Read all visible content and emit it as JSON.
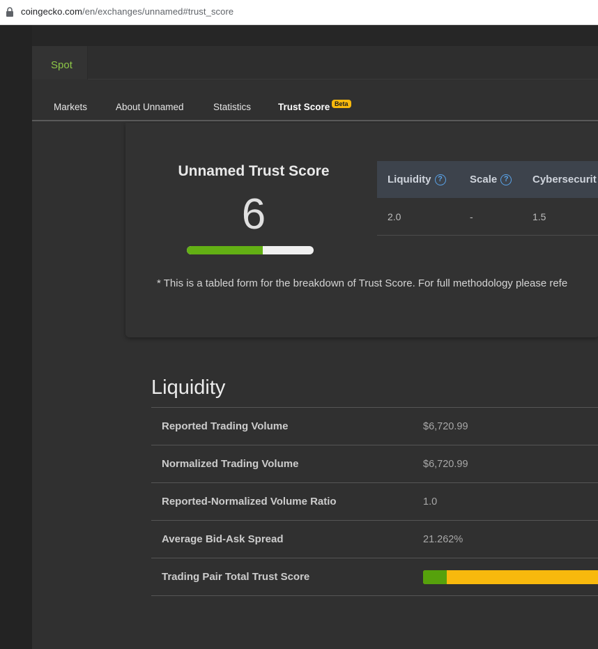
{
  "browser": {
    "url_host": "coingecko.com",
    "url_path": "/en/exchanges/unnamed#trust_score"
  },
  "top_tabs": {
    "spot_label": "Spot"
  },
  "nav_tabs": [
    {
      "label": "Markets"
    },
    {
      "label": "About Unnamed"
    },
    {
      "label": "Statistics"
    },
    {
      "label": "Trust Score",
      "badge": "Beta",
      "active": true
    }
  ],
  "trust_score": {
    "title": "Unnamed Trust Score",
    "score": "6",
    "score_fraction": 0.6
  },
  "breakdown_table": {
    "headers": [
      "Liquidity",
      "Scale",
      "Cybersecurit"
    ],
    "values": [
      "2.0",
      "-",
      "1.5"
    ]
  },
  "note": "* This is a tabled form for the breakdown of Trust Score. For full methodology please refe",
  "liquidity": {
    "title": "Liquidity",
    "rows": [
      {
        "label": "Reported Trading Volume",
        "value": "$6,720.99"
      },
      {
        "label": "Normalized Trading Volume",
        "value": "$6,720.99"
      },
      {
        "label": "Reported-Normalized Volume Ratio",
        "value": "1.0"
      },
      {
        "label": "Average Bid-Ask Spread",
        "value": "21.262%"
      },
      {
        "label": "Trading Pair Total Trust Score",
        "green_fraction": 0.13
      }
    ]
  },
  "colors": {
    "accent_green": "#8dc647",
    "bar_green": "#63b014",
    "bar_yellow": "#f8b90d",
    "help_icon": "#5aa3e8"
  }
}
